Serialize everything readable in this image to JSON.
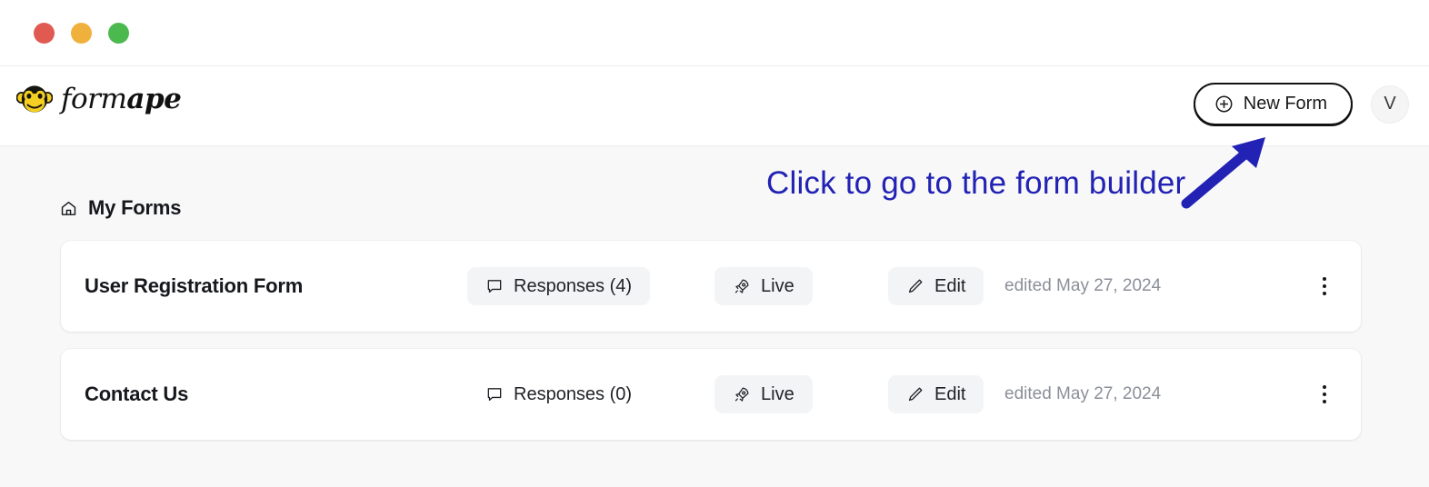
{
  "window": {
    "traffic_lights": [
      {
        "name": "close",
        "color": "#e05a52"
      },
      {
        "name": "minimize",
        "color": "#f0b03c"
      },
      {
        "name": "maximize",
        "color": "#4cb94f"
      }
    ]
  },
  "header": {
    "logo_icon": "monkey-face-icon",
    "wordmark_light": "form",
    "wordmark_bold": "ape",
    "new_form_button": {
      "label": "New Form",
      "icon": "plus-circle-icon"
    },
    "avatar_initial": "V"
  },
  "main": {
    "section_icon": "home-icon",
    "section_title": "My Forms",
    "forms": [
      {
        "name": "User Registration Form",
        "responses_label": "Responses (4)",
        "responses_icon": "message-square-icon",
        "responses_highlighted": true,
        "live_label": "Live",
        "live_icon": "rocket-icon",
        "edit_label": "Edit",
        "edit_icon": "pencil-icon",
        "edited_text": "edited May 27, 2024",
        "menu_icon": "kebab-menu-icon"
      },
      {
        "name": "Contact Us",
        "responses_label": "Responses (0)",
        "responses_icon": "message-square-icon",
        "responses_highlighted": false,
        "live_label": "Live",
        "live_icon": "rocket-icon",
        "edit_label": "Edit",
        "edit_icon": "pencil-icon",
        "edited_text": "edited May 27, 2024",
        "menu_icon": "kebab-menu-icon"
      }
    ]
  },
  "annotation": {
    "text": "Click to go to the form builder",
    "color": "#2222b4",
    "arrow_icon": "arrow-up-right-icon"
  },
  "colors": {
    "page_background": "#f8f8f9",
    "card_background": "#ffffff",
    "header_background": "#ffffff",
    "text_primary": "#16181d",
    "text_muted": "#8b8f98",
    "pill_shaded": "#f3f4f6",
    "button_border": "#121212",
    "logo_yellow": "#f5cf21"
  }
}
